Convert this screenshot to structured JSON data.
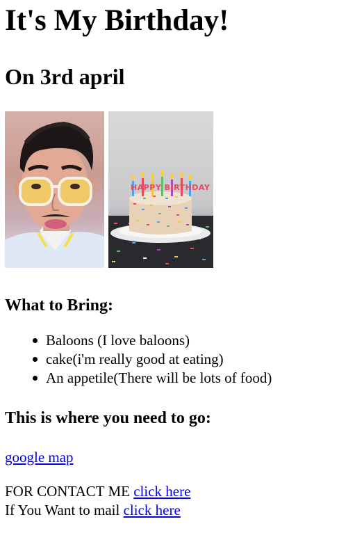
{
  "page": {
    "title": "It's My Birthday!",
    "date_heading": "On 3rd april"
  },
  "photos": {
    "portrait_icon": "person-portrait-icon",
    "cake_icon": "birthday-cake-icon",
    "cake_banner": "HAPPY BIRTHDAY"
  },
  "bring": {
    "heading": "What to Bring:",
    "items": [
      "Baloons (I love baloons)",
      "cake(i'm really good at eating)",
      "An appetile(There will be lots of food)"
    ]
  },
  "location": {
    "heading": "This is where you need to go:",
    "map_link": "google map"
  },
  "contact": {
    "contact_prefix": "FOR CONTACT ME",
    "contact_link": "click here",
    "mail_prefix": "If You Want to mail",
    "mail_link": "click here"
  },
  "colors": {
    "link": "#0000ee",
    "text": "#000000",
    "background": "#ffffff"
  }
}
